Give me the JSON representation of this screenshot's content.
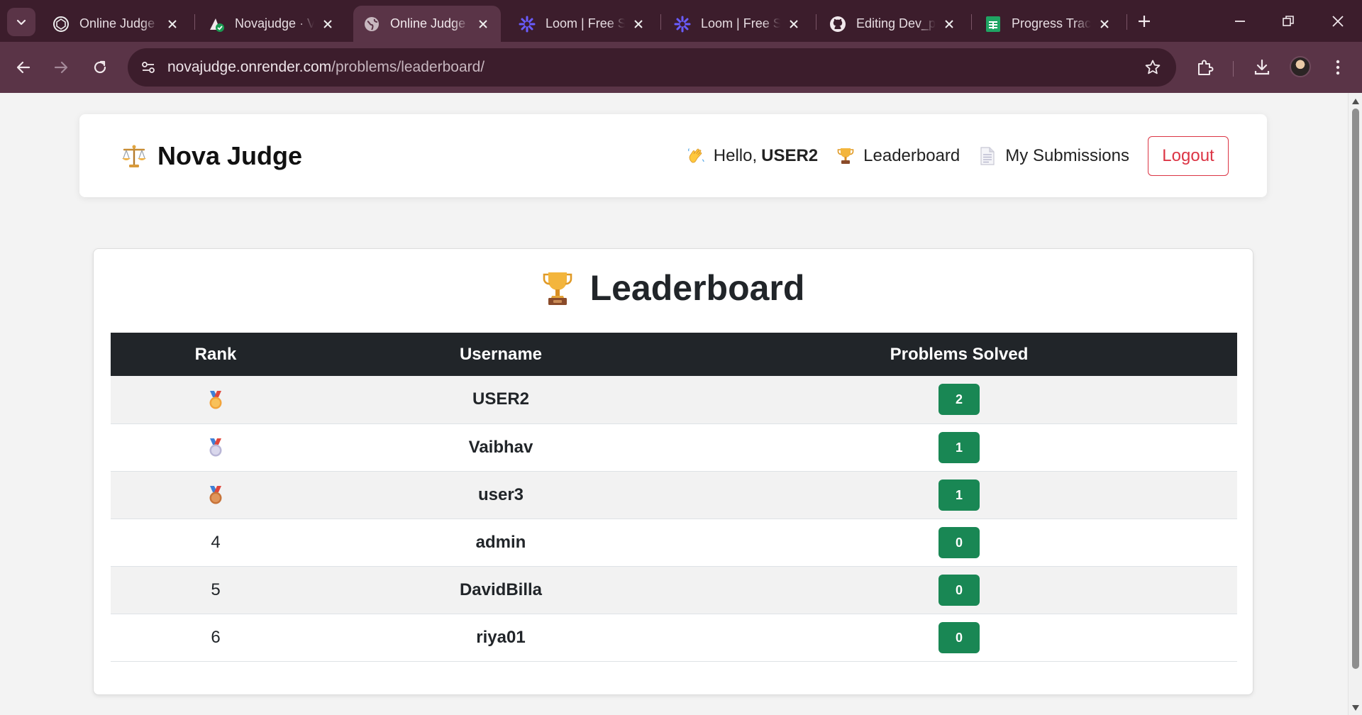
{
  "browser": {
    "tabs": [
      {
        "title": "Online Judge",
        "icon": "openai-icon",
        "active": false
      },
      {
        "title": "Novajudge · Vercel",
        "icon": "vercel-check-icon",
        "active": false
      },
      {
        "title": "Online Judge",
        "icon": "globe-icon",
        "active": true
      },
      {
        "title": "Loom | Free Screen",
        "icon": "loom-icon",
        "active": false
      },
      {
        "title": "Loom | Free Screen",
        "icon": "loom-icon",
        "active": false
      },
      {
        "title": "Editing Dev_pro",
        "icon": "github-icon",
        "active": false
      },
      {
        "title": "Progress Tracker",
        "icon": "sheets-icon",
        "active": false
      }
    ],
    "address": {
      "host": "novajudge.onrender.com",
      "path": "/problems/leaderboard/"
    }
  },
  "navbar": {
    "brand": "Nova Judge",
    "greeting_prefix": "Hello,",
    "username": "USER2",
    "leaderboard_label": "Leaderboard",
    "submissions_label": "My Submissions",
    "logout_label": "Logout"
  },
  "leaderboard": {
    "title": "Leaderboard",
    "columns": [
      "Rank",
      "Username",
      "Problems Solved"
    ],
    "rows": [
      {
        "rank": "1",
        "medal": "gold-medal-icon",
        "username": "USER2",
        "solved": "2"
      },
      {
        "rank": "2",
        "medal": "silver-medal-icon",
        "username": "Vaibhav",
        "solved": "1"
      },
      {
        "rank": "3",
        "medal": "bronze-medal-icon",
        "username": "user3",
        "solved": "1"
      },
      {
        "rank": "4",
        "medal": "",
        "username": "admin",
        "solved": "0"
      },
      {
        "rank": "5",
        "medal": "",
        "username": "DavidBilla",
        "solved": "0"
      },
      {
        "rank": "6",
        "medal": "",
        "username": "riya01",
        "solved": "0"
      }
    ]
  },
  "colors": {
    "chrome_dark": "#3c1d2c",
    "chrome_mid": "#5a3447",
    "table_header": "#212529",
    "badge_green": "#198754",
    "logout_red": "#dc3545"
  }
}
